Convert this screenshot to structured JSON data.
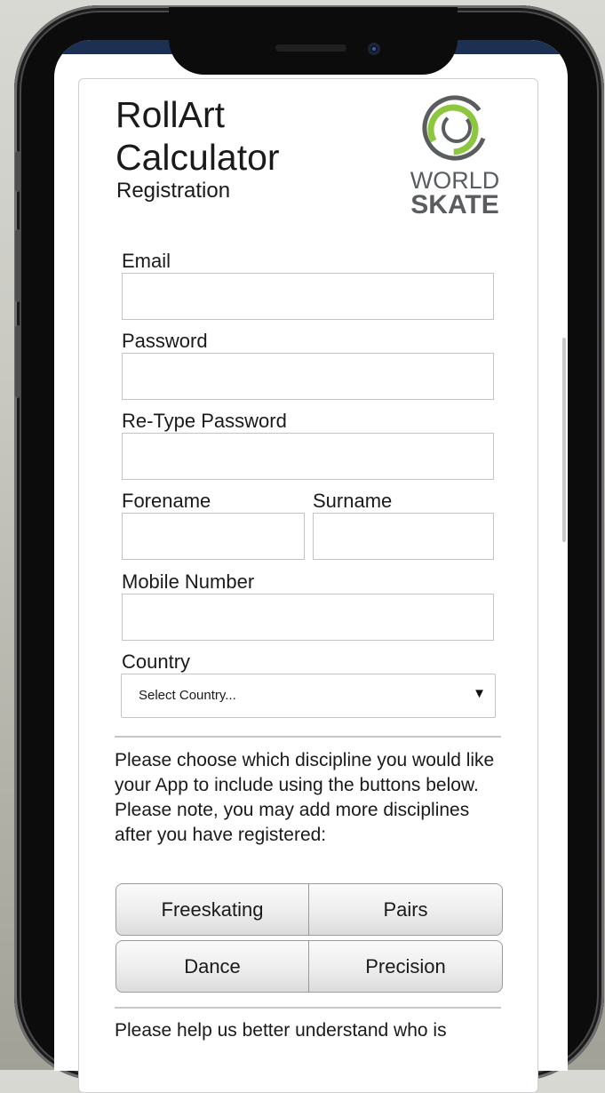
{
  "header": {
    "title_line1": "RollArt",
    "title_line2": "Calculator",
    "subtitle": "Registration"
  },
  "logo": {
    "word1": "WORLD",
    "word2": "SKATE",
    "ring_color": "#5a5d5f",
    "accent_color": "#8dc63f"
  },
  "form": {
    "email_label": "Email",
    "password_label": "Password",
    "retype_password_label": "Re-Type Password",
    "forename_label": "Forename",
    "surname_label": "Surname",
    "mobile_label": "Mobile Number",
    "country_label": "Country",
    "country_selected": "Select Country...",
    "country_arrow": "▼"
  },
  "disciplines": {
    "intro": "Please choose which discipline you would like your App to include using the buttons below. Please note, you may add more disciplines after you have registered:",
    "buttons": [
      "Freeskating",
      "Pairs",
      "Dance",
      "Precision"
    ]
  },
  "footer_text": "Please help us better understand who is",
  "colors": {
    "status_bar": "#1b3053",
    "button_border": "#9a9a9a"
  }
}
